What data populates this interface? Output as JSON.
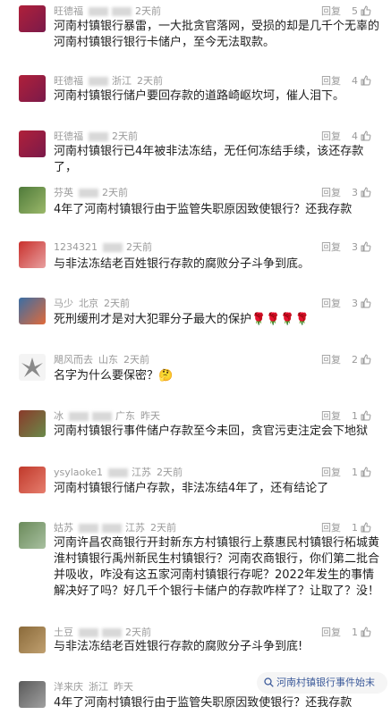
{
  "comments": [
    {
      "user": "旺德福",
      "location": "",
      "time": "2天前",
      "text": "河南村镇银行暴雷，一大批贪官落网，受损的却是几千个无辜的河南村镇银行银行卡储户，至今无法取款。",
      "reply": "回复",
      "likes": "5"
    },
    {
      "user": "旺德福",
      "location": "浙江",
      "time": "2天前",
      "text": "河南村镇银行储户要回存款的道路崎岖坎坷，催人泪下。",
      "reply": "回复",
      "likes": "4"
    },
    {
      "user": "旺德福",
      "location": "",
      "time": "2天前",
      "text": "河南村镇银行已4年被非法冻结，无任何冻结手续，该还存款了，",
      "reply": "回复",
      "likes": "4"
    },
    {
      "user": "芬英",
      "location": "",
      "time": "2天前",
      "text": "4年了河南村镇银行由于监管失职原因致使银行？还我存款",
      "reply": "回复",
      "likes": "3"
    },
    {
      "user": "1234321",
      "location": "",
      "time": "2天前",
      "text": "与非法冻结老百姓银行存款的腐败分子斗争到底。",
      "reply": "回复",
      "likes": "3"
    },
    {
      "user": "马少",
      "location": "北京",
      "time": "2天前",
      "text": "死刑缓刑才是对大犯罪分子最大的保护🌹🌹🌹🌹",
      "reply": "回复",
      "likes": "3"
    },
    {
      "user": "飓风而去",
      "location": "山东",
      "time": "2天前",
      "text": "名字为什么要保密？🤔",
      "reply": "回复",
      "likes": "2"
    },
    {
      "user": "冰",
      "location": "广东",
      "time": "昨天",
      "text": "河南村镇银行事件储户存款至今未回，贪官污吏注定会下地狱",
      "reply": "回复",
      "likes": "1"
    },
    {
      "user": "ysylaoke1",
      "location": "江苏",
      "time": "2天前",
      "text": "河南村镇银行储户存款，非法冻结4年了，还有结论了",
      "reply": "回复",
      "likes": "1"
    },
    {
      "user": "姑苏",
      "location": "江苏",
      "time": "2天前",
      "text": "河南许昌农商银行开封新东方村镇银行上蔡惠民村镇银行柘城黄淮村镇银行禹州新民生村镇银行？河南农商银行，你们第二批合并吸收，咋没有这五家河南村镇银行存呢？2022年发生的事情解决好了吗？好几千个银行卡储户的存款咋样了？让取了？没！",
      "reply": "回复",
      "likes": "1"
    },
    {
      "user": "土豆",
      "location": "",
      "time": "2天前",
      "text": "与非法冻结老百姓银行存款的腐败分子斗争到底!",
      "reply": "回复",
      "likes": "1"
    },
    {
      "user": "洋来庆",
      "location": "浙江",
      "time": "昨天",
      "text": "4年了河南村镇银行由于监管失职原因致使银行？还我存款",
      "reply": "",
      "likes": ""
    }
  ],
  "search": {
    "text": "河南村镇银行事件始末"
  },
  "colors": {
    "meta": "#9a9a9a",
    "text": "#1e1e1e",
    "search_text": "#3c5a9a",
    "bg": "#ffffff"
  }
}
